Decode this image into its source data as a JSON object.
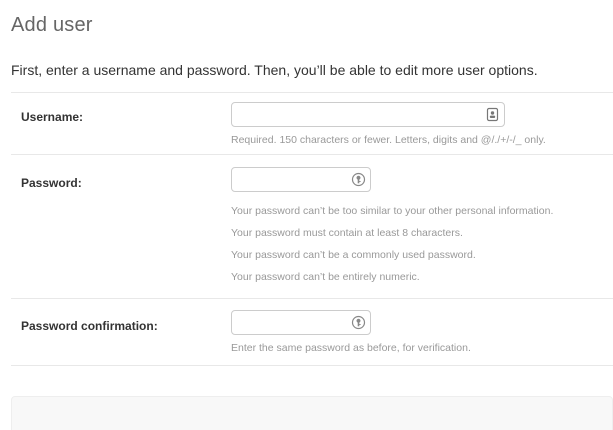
{
  "page": {
    "title": "Add user",
    "intro": "First, enter a username and password. Then, you’ll be able to edit more user options."
  },
  "fields": {
    "username": {
      "label": "Username:",
      "value": "",
      "help": "Required. 150 characters or fewer. Letters, digits and @/./+/-/_ only.",
      "icon": "contact-card-icon"
    },
    "password": {
      "label": "Password:",
      "value": "",
      "icon": "password-manager-icon",
      "help": [
        "Your password can’t be too similar to your other personal information.",
        "Your password must contain at least 8 characters.",
        "Your password can’t be a commonly used password.",
        "Your password can’t be entirely numeric."
      ]
    },
    "password_confirmation": {
      "label": "Password confirmation:",
      "value": "",
      "icon": "password-manager-icon",
      "help": "Enter the same password as before, for verification."
    }
  },
  "colors": {
    "title": "#666666",
    "text": "#333333",
    "help": "#999999",
    "border": "#cccccc",
    "divider": "#e8e8e8",
    "submit_row": "#f8f8f8"
  }
}
